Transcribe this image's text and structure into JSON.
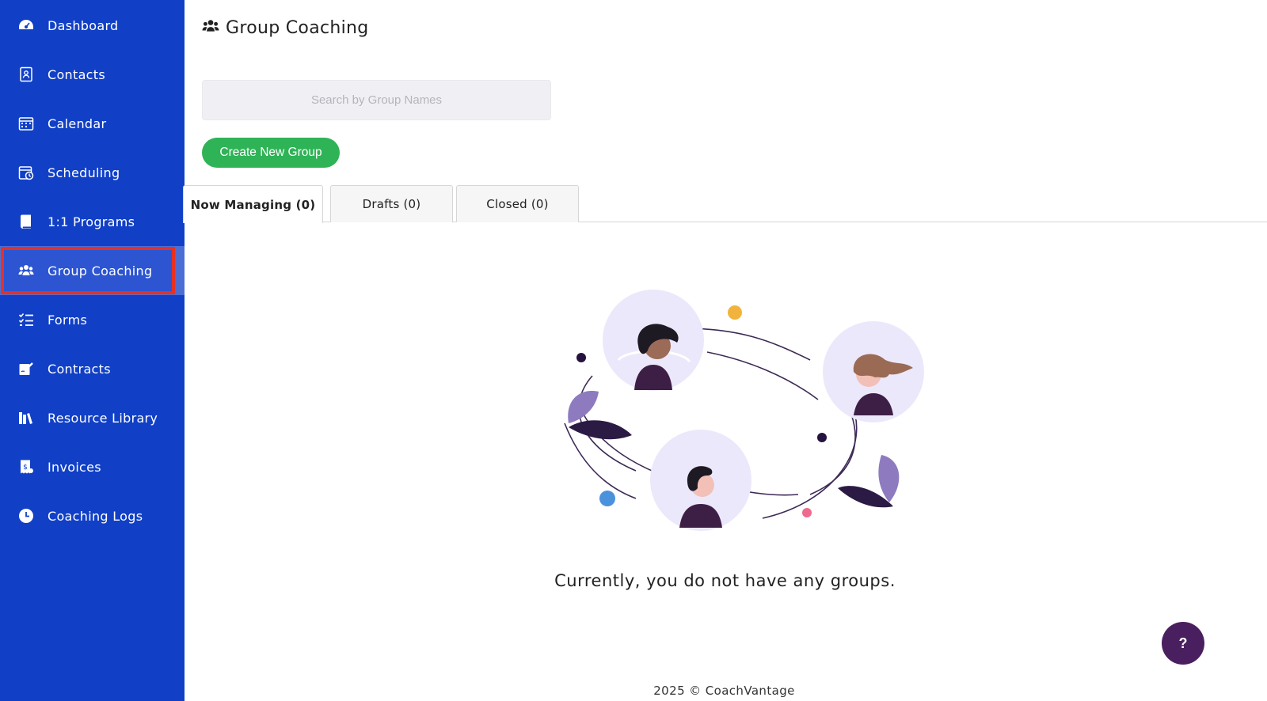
{
  "sidebar": {
    "items": [
      {
        "label": "Dashboard",
        "icon": "dashboard-icon"
      },
      {
        "label": "Contacts",
        "icon": "contacts-icon"
      },
      {
        "label": "Calendar",
        "icon": "calendar-icon"
      },
      {
        "label": "Scheduling",
        "icon": "scheduling-icon"
      },
      {
        "label": "1:1 Programs",
        "icon": "book-icon"
      },
      {
        "label": "Group Coaching",
        "icon": "users-icon",
        "active": true
      },
      {
        "label": "Forms",
        "icon": "checklist-icon"
      },
      {
        "label": "Contracts",
        "icon": "signature-icon"
      },
      {
        "label": "Resource Library",
        "icon": "books-icon"
      },
      {
        "label": "Invoices",
        "icon": "invoice-icon"
      },
      {
        "label": "Coaching Logs",
        "icon": "clock-icon"
      }
    ]
  },
  "header": {
    "title": "Group Coaching",
    "icon": "users-icon"
  },
  "search": {
    "placeholder": "Search by Group Names",
    "value": ""
  },
  "actions": {
    "create_label": "Create New Group"
  },
  "tabs": [
    {
      "label": "Now Managing (0)",
      "active": true
    },
    {
      "label": "Drafts (0)",
      "active": false
    },
    {
      "label": "Closed (0)",
      "active": false
    }
  ],
  "empty_state": {
    "message": "Currently, you do not have any groups."
  },
  "help": {
    "label": "?"
  },
  "footer": {
    "text": "2025 © CoachVantage"
  },
  "colors": {
    "sidebar": "#1140c7",
    "active_item": "#4b6ed6",
    "highlight_border": "#e53123",
    "create_button": "#2eb356",
    "help_button": "#4a1f5f"
  }
}
